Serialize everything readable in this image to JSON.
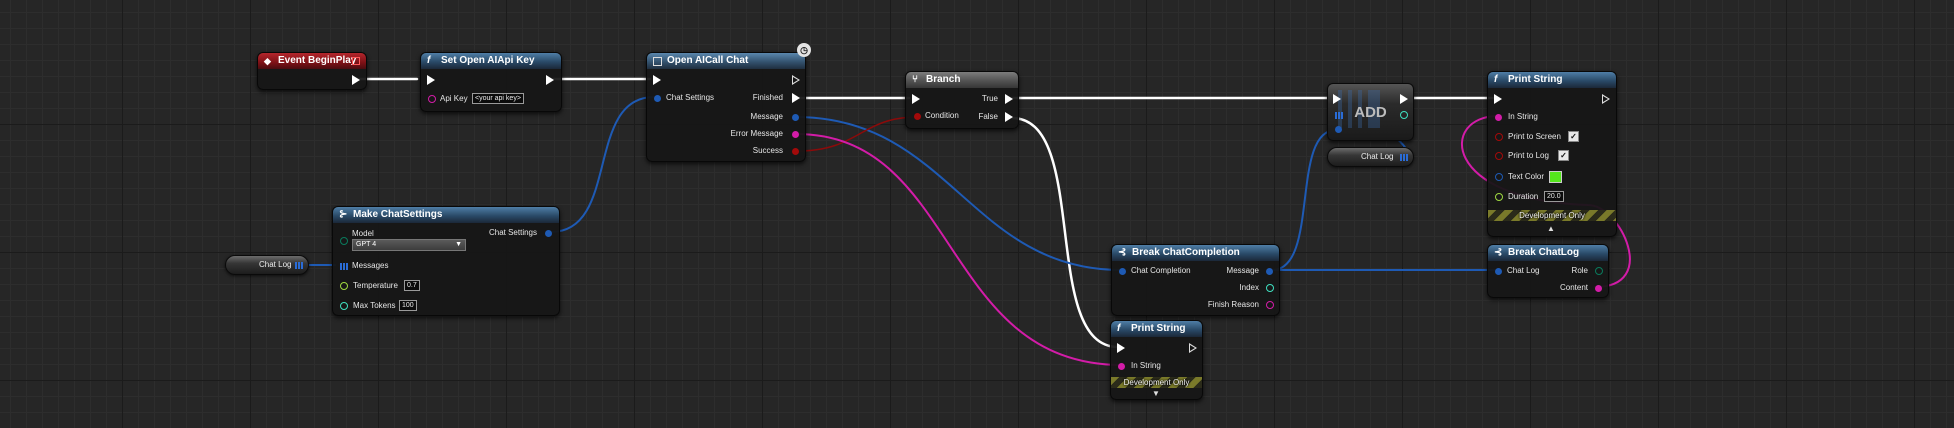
{
  "colors": {
    "background": "#262626",
    "exec_wire": "#ffffff",
    "struct_wire": "#1e5ab4",
    "string_wire": "#d31ca8",
    "bool_pin": "#a30a0a",
    "int_pin": "#3fe0c0",
    "float_pin": "#9fd940",
    "text_color_swatch": "#55e61d"
  },
  "nodes": {
    "event_begin_play": {
      "title": "Event BeginPlay",
      "icon": "event-diamond-icon"
    },
    "set_openai_api_key": {
      "title": "Set Open AIApi Key",
      "icon": "function-icon",
      "api_key_label": "Api Key",
      "api_key_value": "<your api key>"
    },
    "open_ai_call_chat": {
      "title": "Open AICall Chat",
      "icon": "async-node-icon",
      "latent_icon": "clock-icon",
      "chat_settings_label": "Chat Settings",
      "finished_label": "Finished",
      "message_label": "Message",
      "error_message_label": "Error Message",
      "success_label": "Success"
    },
    "branch": {
      "title": "Branch",
      "icon": "branch-icon",
      "condition_label": "Condition",
      "true_label": "True",
      "false_label": "False"
    },
    "make_chat_settings": {
      "title": "Make ChatSettings",
      "icon": "make-struct-icon",
      "model_label": "Model",
      "model_value": "GPT 4",
      "messages_label": "Messages",
      "temperature_label": "Temperature",
      "temperature_value": "0.7",
      "max_tokens_label": "Max Tokens",
      "max_tokens_value": "100",
      "output_label": "Chat Settings"
    },
    "chat_log_variable_left": {
      "label": "Chat Log"
    },
    "add": {
      "label": "ADD"
    },
    "chat_log_variable_right": {
      "label": "Chat Log"
    },
    "print_string_top": {
      "title": "Print String",
      "icon": "function-icon",
      "in_string_label": "In String",
      "print_to_screen_label": "Print to Screen",
      "print_to_screen_checked": true,
      "print_to_log_label": "Print to Log",
      "print_to_log_checked": true,
      "text_color_label": "Text Color",
      "duration_label": "Duration",
      "duration_value": "20.0",
      "dev_only_label": "Development Only"
    },
    "break_chat_completion": {
      "title": "Break ChatCompletion",
      "icon": "break-struct-icon",
      "chat_completion_label": "Chat Completion",
      "message_label": "Message",
      "index_label": "Index",
      "finish_reason_label": "Finish Reason"
    },
    "break_chat_log": {
      "title": "Break ChatLog",
      "icon": "break-struct-icon",
      "chat_log_label": "Chat Log",
      "role_label": "Role",
      "content_label": "Content"
    },
    "print_string_bottom": {
      "title": "Print String",
      "icon": "function-icon",
      "in_string_label": "In String",
      "dev_only_label": "Development Only"
    }
  }
}
